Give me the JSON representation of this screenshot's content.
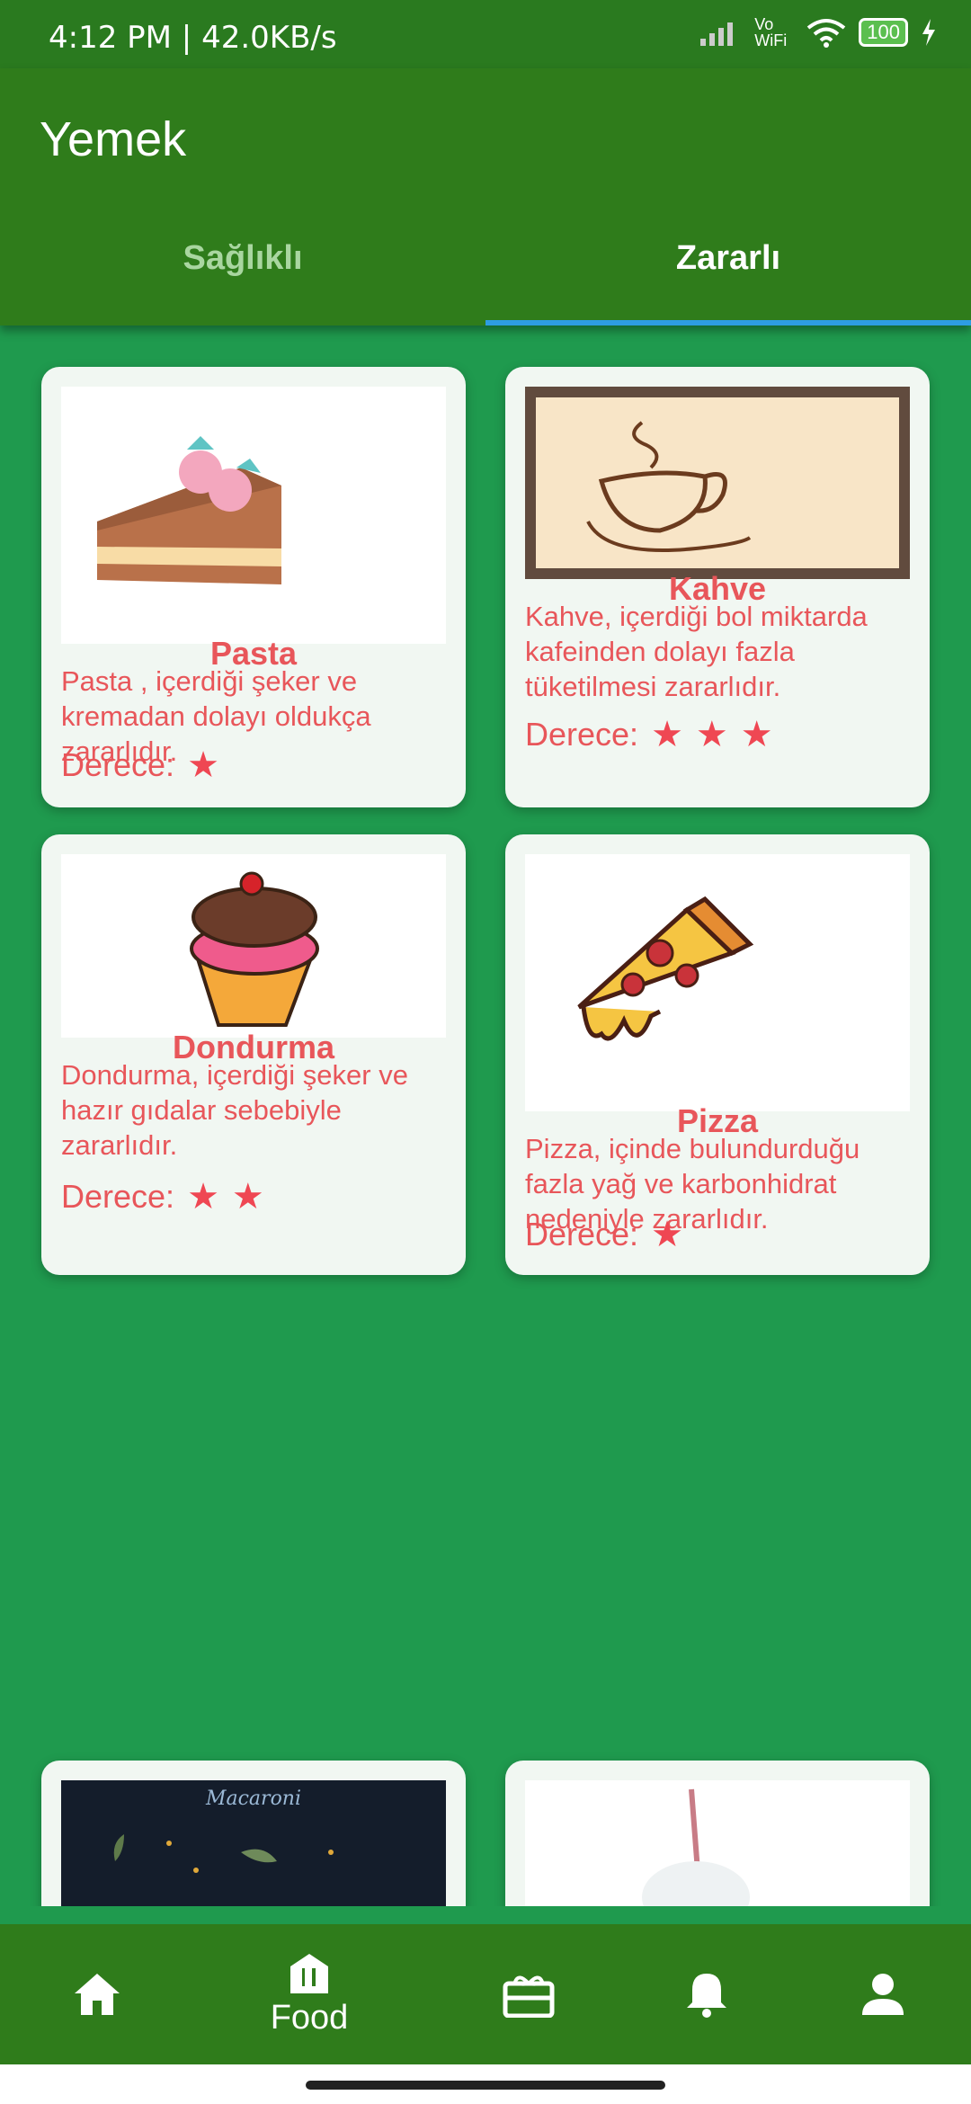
{
  "status": {
    "time": "4:12 PM | 42.0KB/s",
    "battery": "100",
    "network": "Vo WiFi"
  },
  "appbar": {
    "title": "Yemek"
  },
  "tabs": [
    {
      "label": "Sağlıklı"
    },
    {
      "label": "Zararlı"
    }
  ],
  "cards": [
    {
      "name": "Pasta",
      "desc": "Pasta , içerdiği şeker ve kremadan dolayı oldukça zararlıdır.",
      "rating_label": "Derece:",
      "stars": 1
    },
    {
      "name": "Kahve",
      "desc": "Kahve, içerdiği bol miktarda kafeinden dolayı fazla tüketilmesi zararlıdır.",
      "rating_label": "Derece:",
      "stars": 3
    },
    {
      "name": "Dondurma",
      "desc": "Dondurma, içerdiği şeker ve hazır gıdalar sebebiyle zararlıdır.",
      "rating_label": "Derece:",
      "stars": 2
    },
    {
      "name": "Pizza",
      "desc": "Pizza, içinde bulundurduğu fazla yağ ve karbonhidrat nedeniyle zararlıdır.",
      "rating_label": "Derece:",
      "stars": 1
    },
    {
      "name": "",
      "desc": "",
      "rating_label": "",
      "stars": 0,
      "image_text": "Macaroni"
    },
    {
      "name": "",
      "desc": "",
      "rating_label": "",
      "stars": 0
    }
  ],
  "bottomnav": {
    "food_label": "Food"
  },
  "colors": {
    "appbar": "#2f7c1b",
    "background": "#1f9a4e",
    "accent_text": "#e8565a",
    "tab_indicator": "#2d9de3"
  },
  "icons": [
    "home-icon",
    "food-icon",
    "gift-icon",
    "bell-icon",
    "person-icon"
  ]
}
